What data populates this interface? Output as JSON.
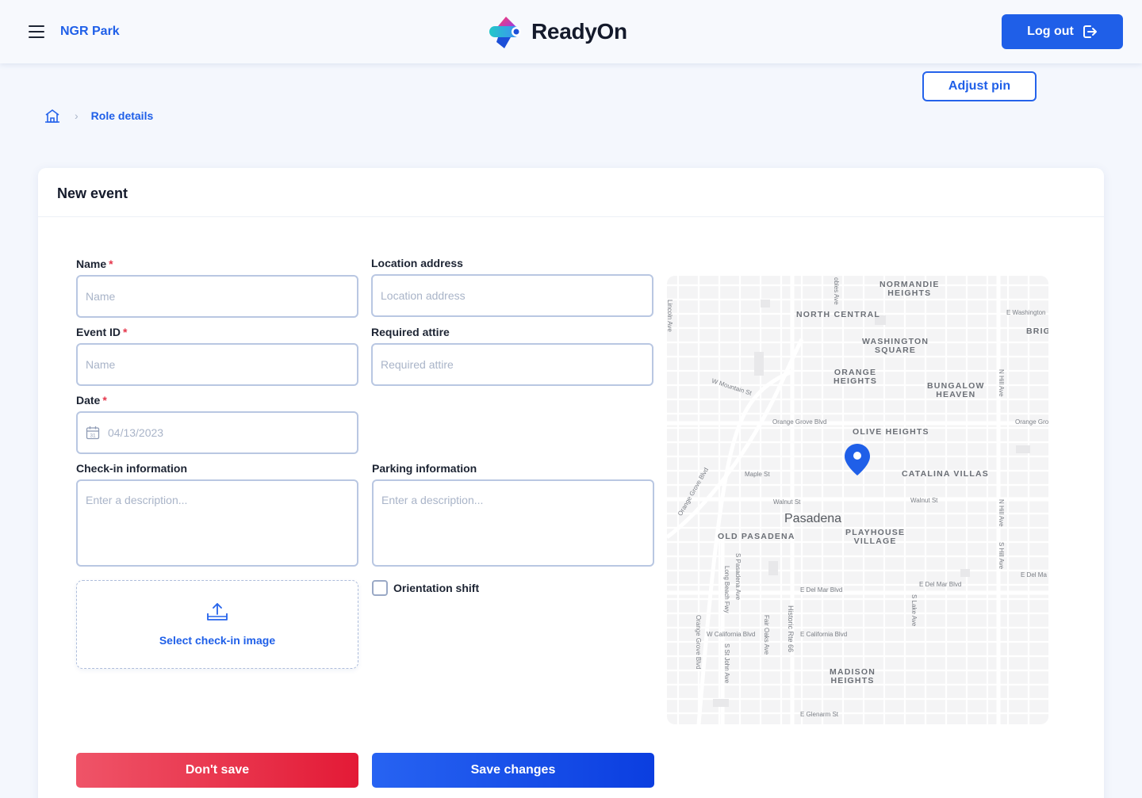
{
  "header": {
    "menu_icon": "hamburger-menu-icon",
    "org_name": "NGR Park",
    "logo_text": "ReadyOn",
    "logout_label": "Log out",
    "logout_icon": "logout-icon"
  },
  "adjust_pin_label": "Adjust pin",
  "breadcrumb": {
    "home_icon": "home-icon",
    "separator_icon": "chevron-right-icon",
    "current": "Role details"
  },
  "form": {
    "title": "New event",
    "name": {
      "label": "Name",
      "required_mark": "*",
      "placeholder": "Name"
    },
    "location": {
      "label": "Location address",
      "placeholder": "Location address"
    },
    "event_id": {
      "label": "Event ID",
      "required_mark": "*",
      "placeholder": "Name"
    },
    "attire": {
      "label": "Required attire",
      "placeholder": "Required attire"
    },
    "date": {
      "label": "Date",
      "required_mark": "*",
      "value": "04/13/2023",
      "icon": "calendar-icon",
      "icon_day": "31"
    },
    "checkin": {
      "label": "Check-in information",
      "placeholder": "Enter a description..."
    },
    "parking": {
      "label": "Parking information",
      "placeholder": "Enter a description..."
    },
    "upload": {
      "label": "Select check-in image",
      "icon": "upload-icon"
    },
    "orientation": {
      "label": "Orientation shift",
      "checked": false
    }
  },
  "map": {
    "city": "Pasadena",
    "pin_icon": "map-pin-icon",
    "neighborhoods": {
      "normandie": "NORMANDIE\nHEIGHTS",
      "north_central": "NORTH CENTRAL",
      "washington": "WASHINGTON\nSQUARE",
      "orange": "ORANGE\nHEIGHTS",
      "bungalow": "BUNGALOW\nHEAVEN",
      "brig": "BRIG",
      "olive": "OLIVE HEIGHTS",
      "catalina": "CATALINA VILLAS",
      "old_pasadena": "OLD PASADENA",
      "playhouse": "PLAYHOUSE\nVILLAGE",
      "madison": "MADISON\nHEIGHTS"
    },
    "streets": {
      "lincoln": "Lincoln Ave",
      "robles": "obles Ave",
      "e_washington": "E Washington",
      "w_mountain": "W Mountain St",
      "n_hill": "N Hill Ave",
      "orange_grove_1": "Orange Grove Blvd",
      "orange_grove_2": "Orange Gro",
      "orange_grove_diag": "Orange Grove Blvd",
      "maple": "Maple St",
      "walnut_1": "Walnut St",
      "walnut_2": "Walnut St",
      "n_hill_2": "N Hill Ave",
      "s_hill": "S Hill Ave",
      "e_del_mar_1": "E Del Mar Blvd",
      "e_del_mar_2": "E Del Mar Blvd",
      "e_del_mar_3": "E Del Ma",
      "s_pasadena": "S Pasadena Ave",
      "long_beach": "Long Beach Fwy",
      "s_lake": "S Lake Ave",
      "fair_oaks": "Fair Oaks Ave",
      "historic": "Historic Rte 66",
      "w_california": "W California Blvd",
      "e_california": "E California Blvd",
      "orange_grove_3": "Orange Grove Blvd",
      "s_st_john": "S St John Ave",
      "e_glenarm": "E Glenarm St"
    }
  },
  "actions": {
    "dont_save": "Don't save",
    "save": "Save changes"
  },
  "colors": {
    "primary": "#1f5fe8",
    "danger": "#e31a36",
    "background": "#f4f7fd"
  }
}
